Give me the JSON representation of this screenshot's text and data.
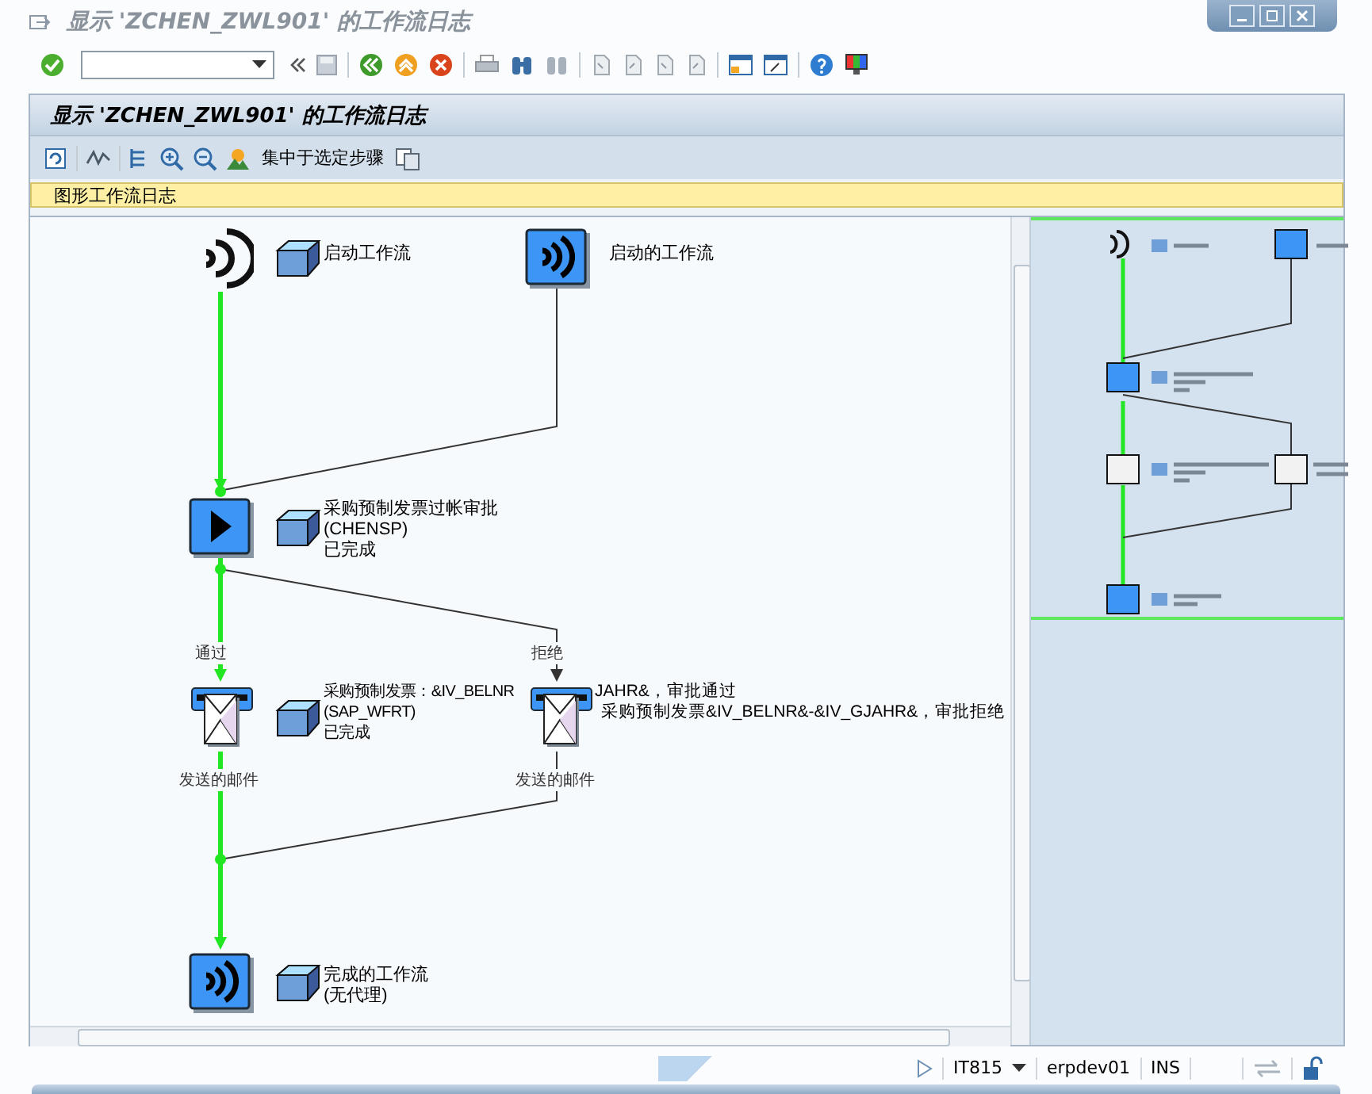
{
  "window": {
    "title": "显示 'ZCHEN_ZWL901' 的工作流日志"
  },
  "panel": {
    "title": "显示 'ZCHEN_ZWL901' 的工作流日志",
    "app_toolbar": {
      "focus_button": "集中于选定步骤"
    },
    "section": "图形工作流日志"
  },
  "graph": {
    "nodes": [
      {
        "kind": "event",
        "lines": [
          "启动工作流"
        ]
      },
      {
        "kind": "event-box",
        "lines": [
          "启动的工作流"
        ]
      },
      {
        "kind": "activity",
        "lines": [
          "采购预制发票过帐审批",
          "(CHENSP)",
          "已完成"
        ]
      },
      {
        "kind": "mail",
        "lines": [
          "采购预制发票：&IV_BELNR",
          "(SAP_WFRT)",
          "已完成"
        ],
        "continuation": "JAHR&，审批通过"
      },
      {
        "kind": "mail",
        "lines": [
          "采购预制发票&IV_BELNR&-&IV_GJAHR&，审批拒绝"
        ]
      },
      {
        "kind": "event-box",
        "lines": [
          "完成的工作流",
          "(无代理)"
        ]
      }
    ],
    "edges": [
      {
        "completed": true
      },
      {
        "completed": false
      },
      {
        "completed": true
      },
      {
        "completed": false
      },
      {
        "completed": true
      },
      {
        "completed": false
      }
    ],
    "edge_labels": [
      "通过",
      "拒绝",
      "发送的邮件",
      "发送的邮件"
    ]
  },
  "status_bar": {
    "system": "IT815",
    "server": "erpdev01",
    "mode": "INS"
  }
}
